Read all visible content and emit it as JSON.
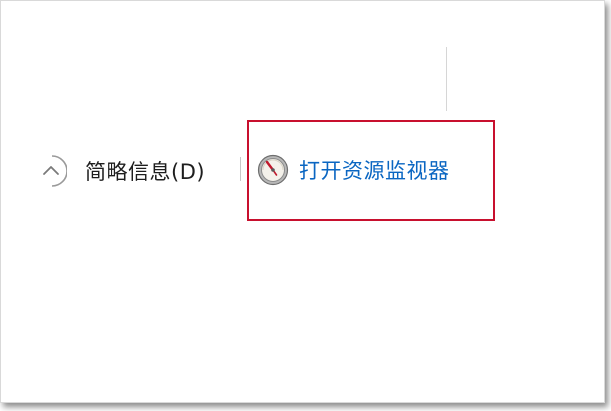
{
  "footer": {
    "collapse": {
      "label": "简略信息(D)",
      "icon": "chevron-up-icon"
    },
    "resource_monitor": {
      "label": "打开资源监视器",
      "icon": "resource-monitor-gauge-icon",
      "link_color": "#0a66c2"
    }
  },
  "annotation": {
    "highlight_color": "#c8102e"
  }
}
